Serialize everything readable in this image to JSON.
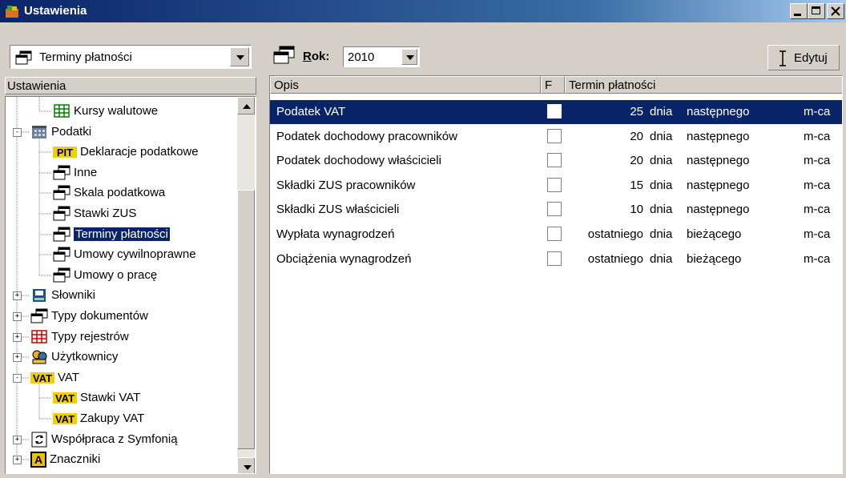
{
  "window": {
    "title": "Ustawienia"
  },
  "left": {
    "combo_value": "Terminy płatności",
    "header": "Ustawienia",
    "tree": [
      {
        "label": "Kursy walutowe",
        "icon": "grid-icon",
        "icon_color": "#008000"
      },
      {
        "label": "Podatki",
        "icon": "building-icon",
        "icon_color": "#808080",
        "expander": "-"
      },
      {
        "label": "Deklaracje podatkowe",
        "icon": "pit-icon",
        "badge": "PIT"
      },
      {
        "label": "Inne",
        "icon": "window-icon"
      },
      {
        "label": "Skala podatkowa",
        "icon": "window-icon"
      },
      {
        "label": "Stawki ZUS",
        "icon": "window-icon"
      },
      {
        "label": "Terminy płatności",
        "icon": "window-icon",
        "selected": true
      },
      {
        "label": "Umowy cywilnoprawne",
        "icon": "window-icon"
      },
      {
        "label": "Umowy o pracę",
        "icon": "window-icon"
      },
      {
        "label": "Słowniki",
        "icon": "book-icon",
        "icon_color": "#1c4fa0",
        "expander": "+"
      },
      {
        "label": "Typy dokumentów",
        "icon": "window-icon",
        "expander": "+"
      },
      {
        "label": "Typy rejestrów",
        "icon": "grid-icon",
        "icon_color": "#cc0000",
        "expander": "+"
      },
      {
        "label": "Użytkownicy",
        "icon": "users-icon",
        "expander": "+"
      },
      {
        "label": "VAT",
        "icon": "vat-icon",
        "badge": "VAT",
        "expander": "-"
      },
      {
        "label": "Stawki VAT",
        "icon": "vat-icon",
        "badge": "VAT"
      },
      {
        "label": "Zakupy VAT",
        "icon": "vat-icon",
        "badge": "VAT"
      },
      {
        "label": "Współpraca z Symfonią",
        "icon": "sync-icon",
        "expander": "+"
      },
      {
        "label": "Znaczniki",
        "icon": "tag-icon",
        "badge": "A",
        "expander": "+"
      }
    ]
  },
  "right": {
    "rok_label": "Rok:",
    "rok_value": "2010",
    "edit_label": "Edytuj",
    "columns": {
      "opis": "Opis",
      "f": "F",
      "termin": "Termin płatności"
    },
    "rows": [
      {
        "opis": "Podatek VAT",
        "num": "25",
        "unit": "dnia",
        "when": "następnego",
        "per": "m-ca",
        "selected": true
      },
      {
        "opis": "Podatek dochodowy pracowników",
        "num": "20",
        "unit": "dnia",
        "when": "następnego",
        "per": "m-ca"
      },
      {
        "opis": "Podatek dochodowy właścicieli",
        "num": "20",
        "unit": "dnia",
        "when": "następnego",
        "per": "m-ca"
      },
      {
        "opis": "Składki ZUS pracowników",
        "num": "15",
        "unit": "dnia",
        "when": "następnego",
        "per": "m-ca"
      },
      {
        "opis": "Składki ZUS właścicieli",
        "num": "10",
        "unit": "dnia",
        "when": "następnego",
        "per": "m-ca"
      },
      {
        "opis": "Wypłata wynagrodzeń",
        "num": "ostatniego",
        "unit": "dnia",
        "when": "bieżącego",
        "per": "m-ca"
      },
      {
        "opis": "Obciążenia wynagrodzeń",
        "num": "ostatniego",
        "unit": "dnia",
        "when": "bieżącego",
        "per": "m-ca"
      }
    ]
  },
  "colors": {
    "selection": "#0a246a",
    "face": "#d4d0c8",
    "title_start": "#0a246a"
  }
}
